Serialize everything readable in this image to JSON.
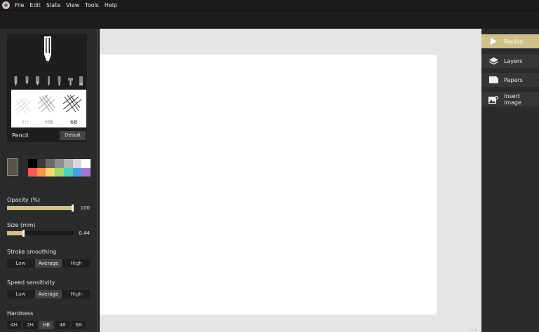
{
  "menu": [
    "File",
    "Edit",
    "Slate",
    "View",
    "Tools",
    "Help"
  ],
  "pencil": {
    "name": "Pencil",
    "default_label": "Default",
    "preview_labels": [
      "4H",
      "HB",
      "6B"
    ]
  },
  "colors": {
    "current": "#5a5248",
    "palette": [
      "#000000",
      "#3a3a3a",
      "#6a6a6a",
      "#8e8e8e",
      "#b3b3b3",
      "#d8d8d8",
      "#ffffff",
      "#f25c54",
      "#f7944a",
      "#f6d76c",
      "#9bd86f",
      "#4fd1b8",
      "#4a9ee8",
      "#a07ad0"
    ],
    "accent": "#cfc089"
  },
  "opacity": {
    "label": "Opacity (%)",
    "value": "100",
    "fraction": 1.0
  },
  "size": {
    "label": "Size (mm)",
    "value": "0.44",
    "fraction": 0.25
  },
  "smoothing": {
    "label": "Stroke smoothing",
    "options": [
      "Low",
      "Average",
      "High"
    ],
    "selected": "Average"
  },
  "speed": {
    "label": "Speed sensitivity",
    "options": [
      "Low",
      "Average",
      "High"
    ],
    "selected": "Average"
  },
  "hardness": {
    "label": "Hardness",
    "options": [
      "4H",
      "2H",
      "HB",
      "4B",
      "6B"
    ],
    "selected": "HB"
  },
  "right_panel": {
    "replay": "Replay",
    "layers": "Layers",
    "papers": "Papers",
    "insert_image": "Insert image"
  }
}
